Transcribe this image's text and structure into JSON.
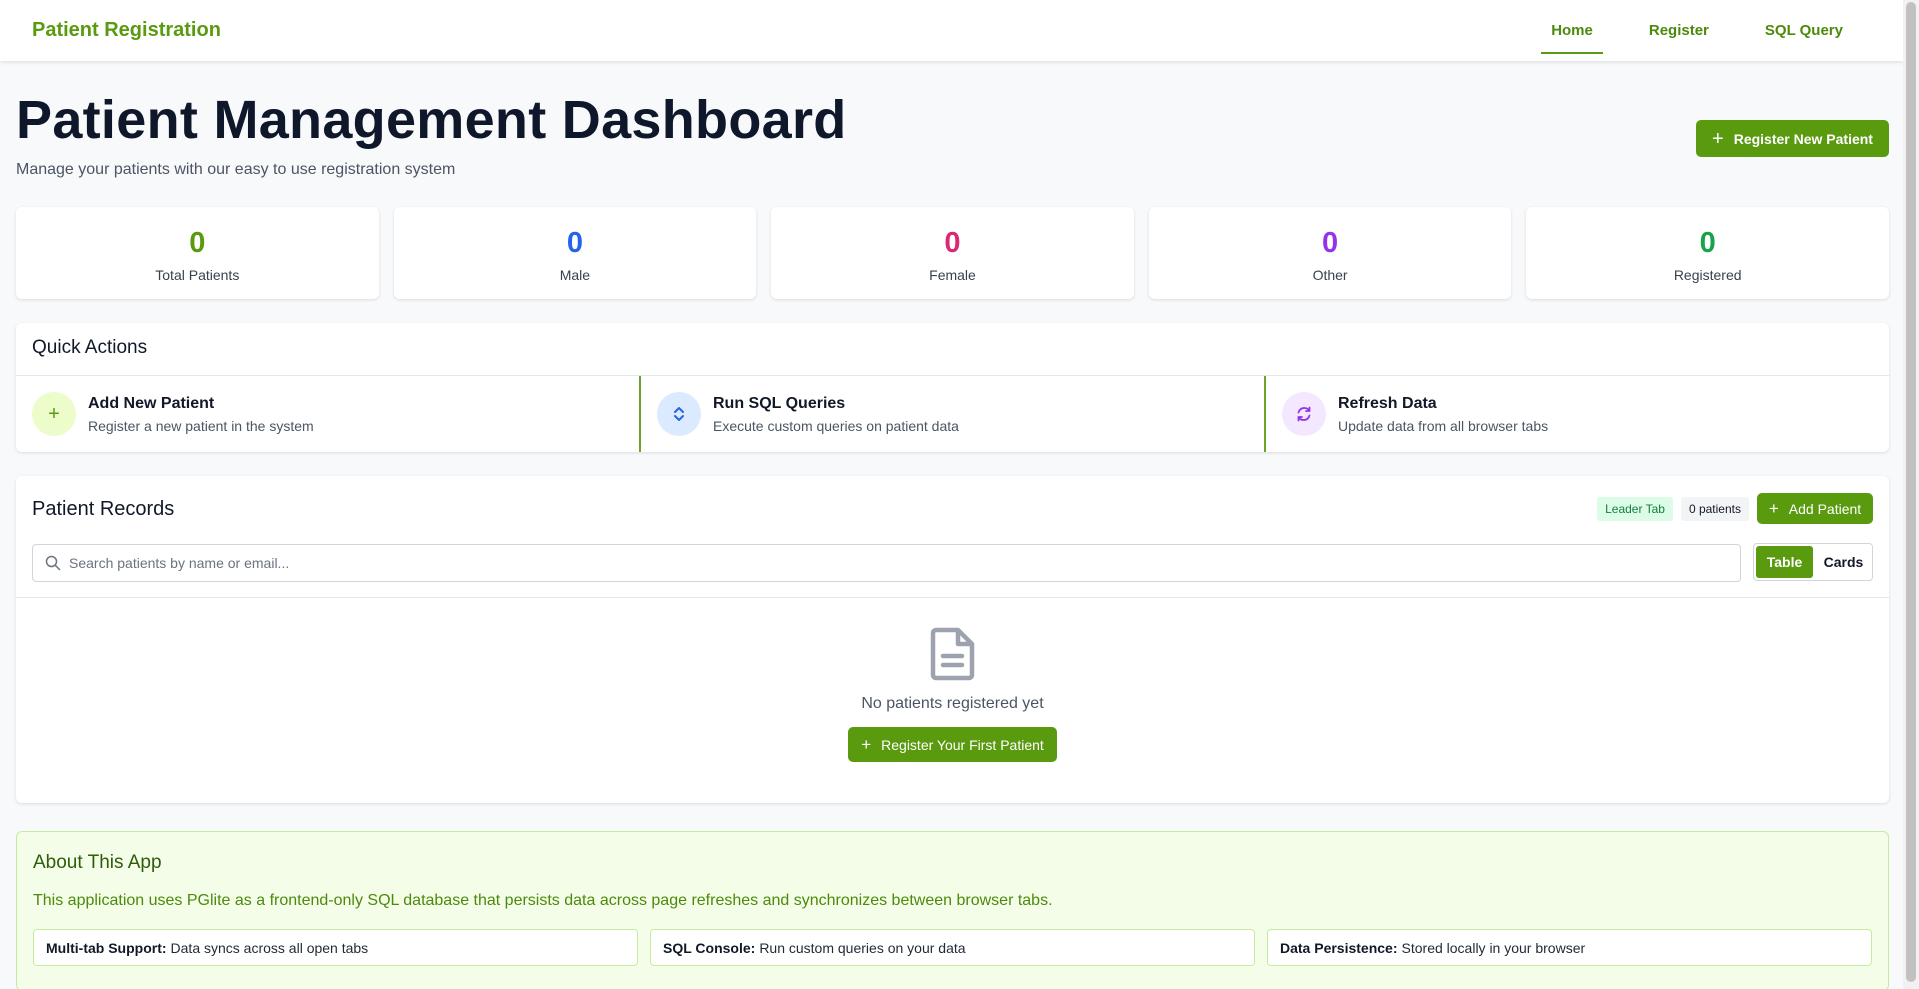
{
  "navbar": {
    "brand": "Patient Registration",
    "links": [
      {
        "label": "Home",
        "active": true
      },
      {
        "label": "Register",
        "active": false
      },
      {
        "label": "SQL Query",
        "active": false
      }
    ]
  },
  "header": {
    "title": "Patient Management Dashboard",
    "subtitle": "Manage your patients with our easy to use registration system",
    "register_button": "Register New Patient"
  },
  "stats": [
    {
      "value": "0",
      "label": "Total Patients",
      "color": "#5a9a0f"
    },
    {
      "value": "0",
      "label": "Male",
      "color": "#2563eb"
    },
    {
      "value": "0",
      "label": "Female",
      "color": "#db2777"
    },
    {
      "value": "0",
      "label": "Other",
      "color": "#9333ea"
    },
    {
      "value": "0",
      "label": "Registered",
      "color": "#16a34a"
    }
  ],
  "quick_actions": {
    "title": "Quick Actions",
    "items": [
      {
        "icon": "plus-icon",
        "title": "Add New Patient",
        "desc": "Register a new patient in the system"
      },
      {
        "icon": "sort-arrows-icon",
        "title": "Run SQL Queries",
        "desc": "Execute custom queries on patient data"
      },
      {
        "icon": "refresh-icon",
        "title": "Refresh Data",
        "desc": "Update data from all browser tabs"
      }
    ]
  },
  "records": {
    "title": "Patient Records",
    "leader_badge": "Leader Tab",
    "count_badge": "0 patients",
    "add_button": "Add Patient",
    "search_placeholder": "Search patients by name or email...",
    "view_table": "Table",
    "view_cards": "Cards",
    "empty_text": "No patients registered yet",
    "first_button": "Register Your First Patient"
  },
  "about": {
    "title": "About This App",
    "desc": "This application uses PGlite as a frontend-only SQL database that persists data across page refreshes and synchronizes between browser tabs.",
    "items": [
      {
        "label": "Multi-tab Support:",
        "text": "Data syncs across all open tabs"
      },
      {
        "label": "SQL Console:",
        "text": "Run custom queries on your data"
      },
      {
        "label": "Data Persistence:",
        "text": "Stored locally in your browser"
      }
    ]
  }
}
